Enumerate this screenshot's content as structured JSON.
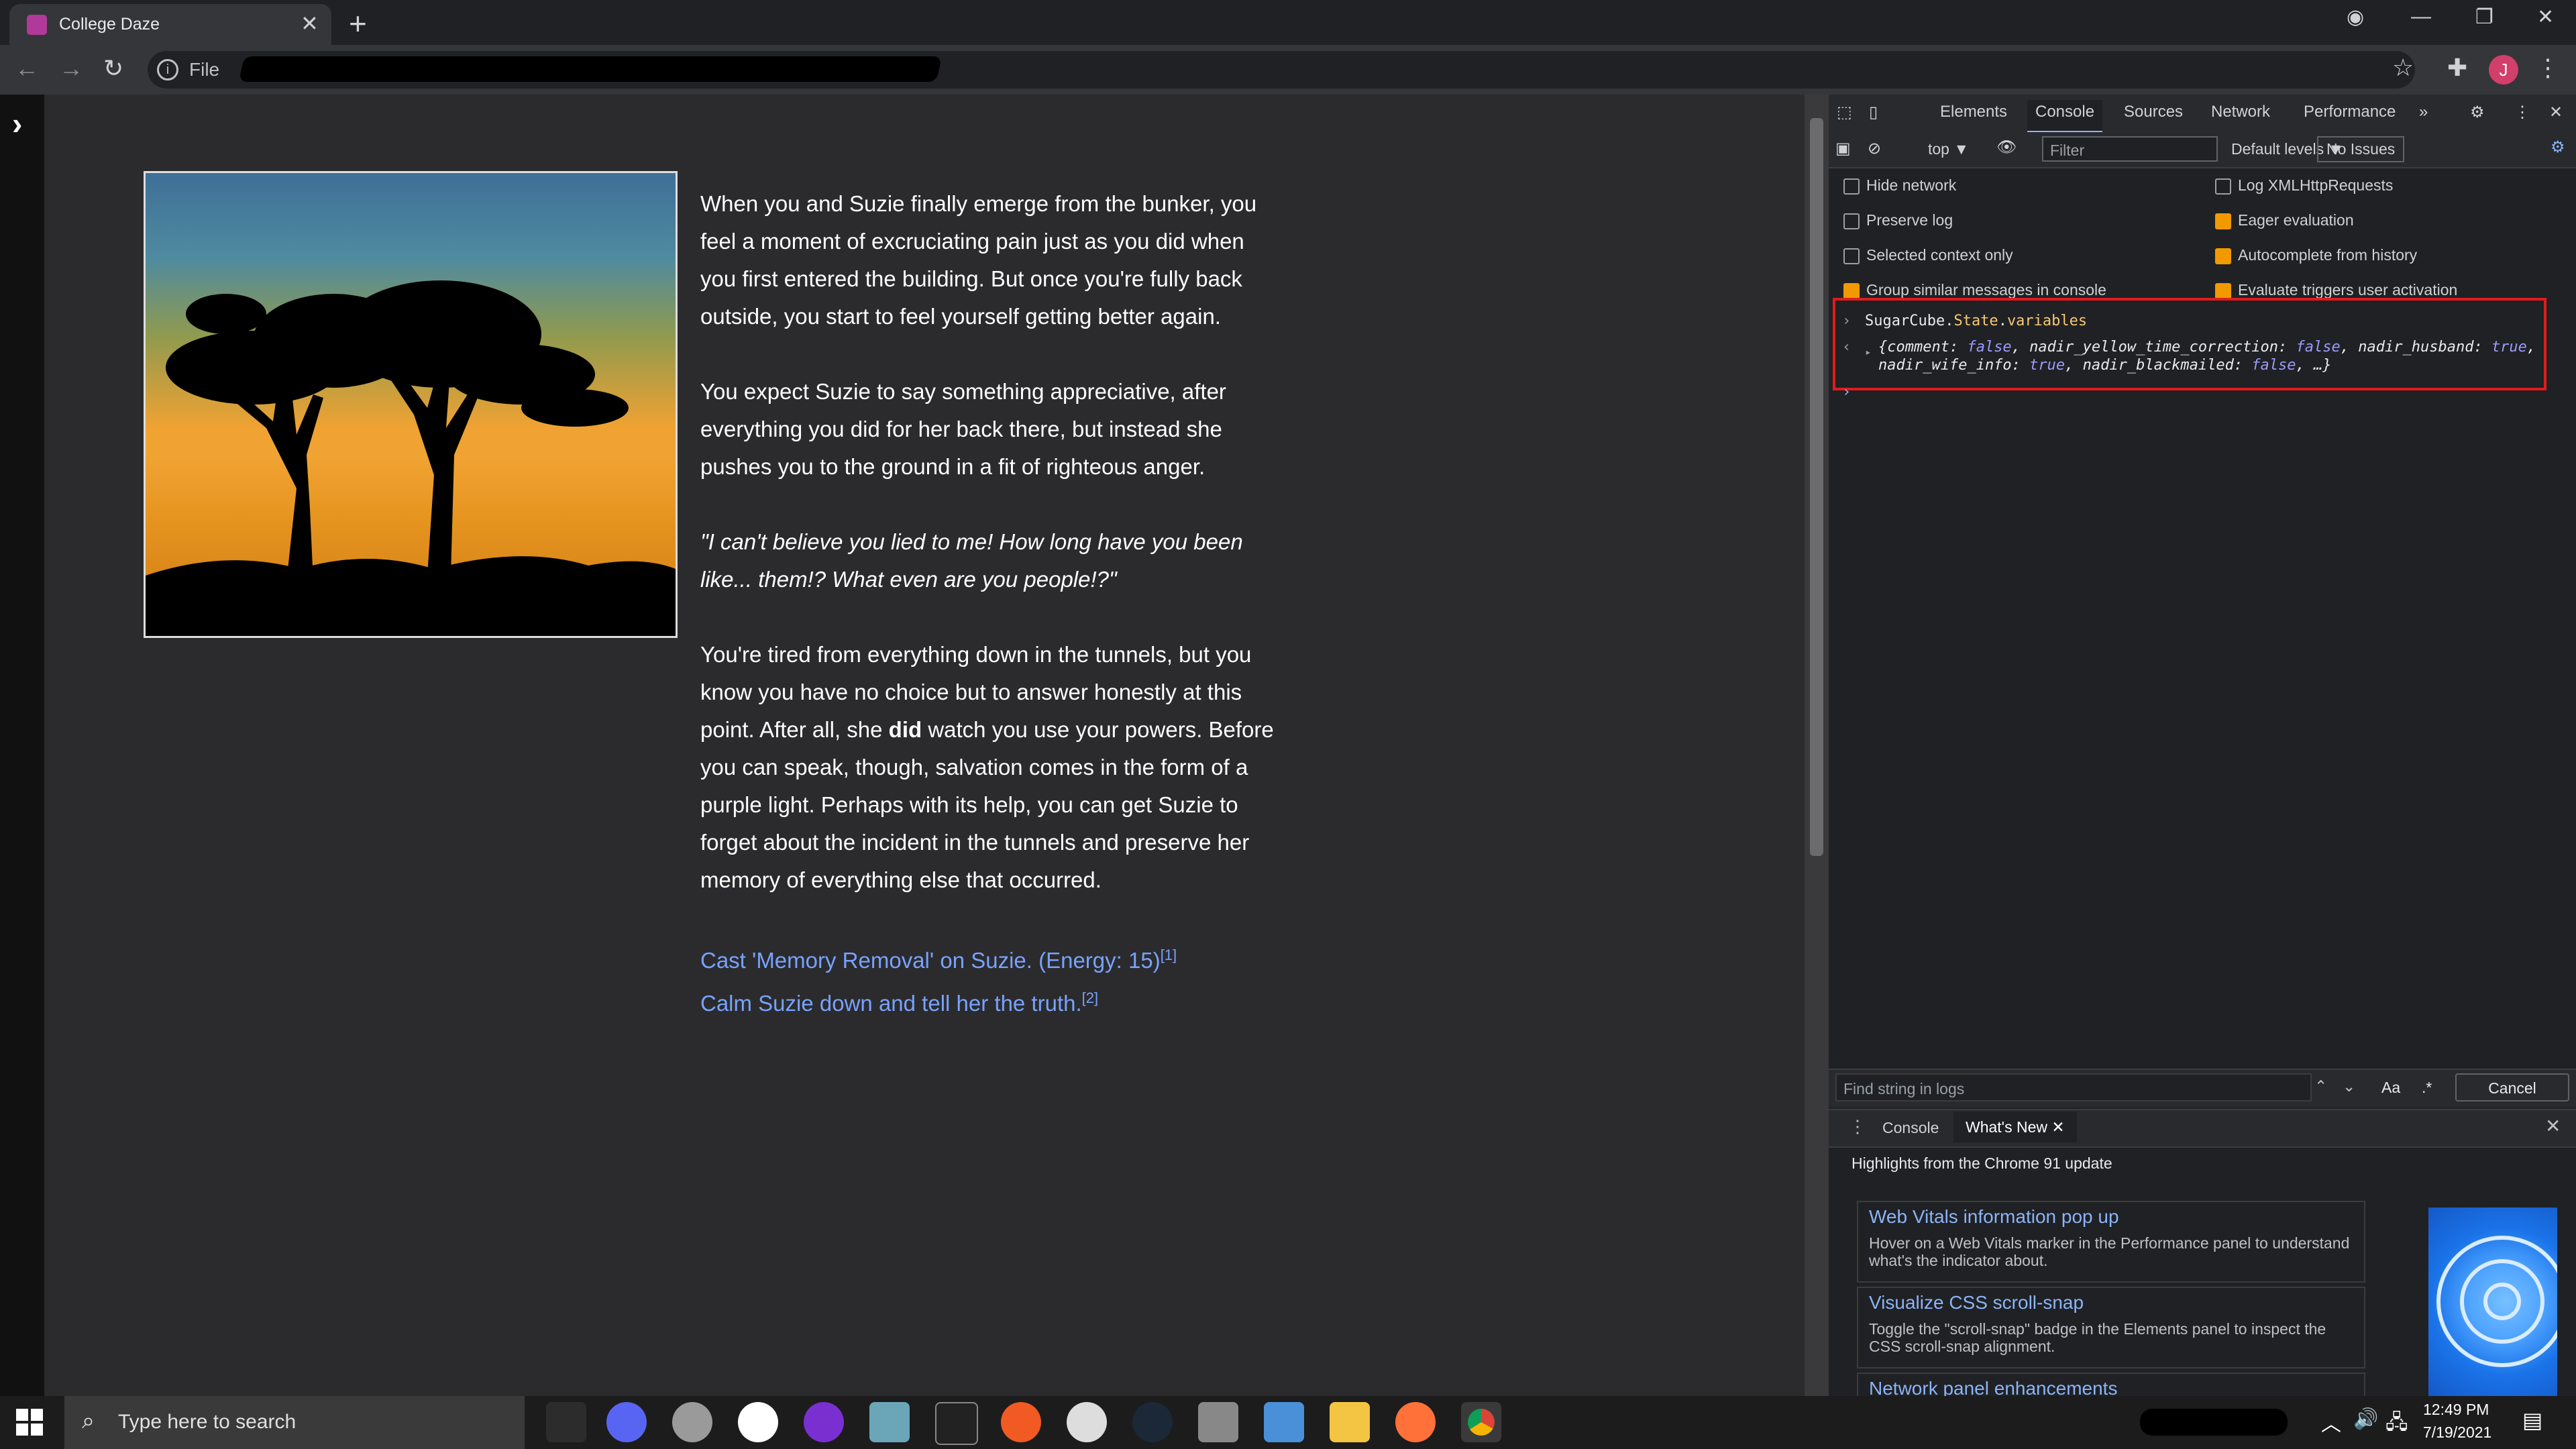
{
  "browser": {
    "tab_title": "College Daze",
    "tab_close": "✕",
    "new_tab": "+",
    "url_label": "File"
  },
  "story": {
    "paragraphs": [
      "When you and Suzie finally emerge from the bunker, you feel a moment of excruciating pain just as you did when you first entered the building. But once you're fully back outside, you start to feel yourself getting better again.",
      "You expect Suzie to say something appreciative, after everything you did for her back there, but instead she pushes you to the ground in a fit of righteous anger."
    ],
    "quote": "\"I can't believe you lied to me! How long have you been like... them!? What even are you people!?\"",
    "p4_before": "You're tired from everything down in the tunnels, but you know you have no choice but to answer honestly at this point. After all, she ",
    "p4_bold": "did",
    "p4_after": " watch you use your powers. Before you can speak, though, salvation comes in the form of a purple light. Perhaps with its help, you can get Suzie to forget about the incident in the tunnels and preserve her memory of everything else that occurred.",
    "choices": [
      {
        "label": "Cast 'Memory Removal' on Suzie. (Energy: 15)",
        "sup": "[1]"
      },
      {
        "label": "Calm Suzie down and tell her the truth.",
        "sup": "[2]"
      }
    ]
  },
  "devtools": {
    "tabs": [
      "Elements",
      "Console",
      "Sources",
      "Network",
      "Performance"
    ],
    "more": "»",
    "context": "top ▼",
    "filter_placeholder": "Filter",
    "levels": "Default levels ▼",
    "issues": "No Issues",
    "settings_left": [
      {
        "label": "Hide network",
        "checked": false
      },
      {
        "label": "Preserve log",
        "checked": false
      },
      {
        "label": "Selected context only",
        "checked": false
      },
      {
        "label": "Group similar messages in console",
        "checked": true
      }
    ],
    "settings_right": [
      {
        "label": "Log XMLHttpRequests",
        "checked": false
      },
      {
        "label": "Eager evaluation",
        "checked": true
      },
      {
        "label": "Autocomplete from history",
        "checked": true
      },
      {
        "label": "Evaluate triggers user activation",
        "checked": true
      }
    ],
    "command": {
      "a": "SugarCube.",
      "b": "State",
      "c": ".",
      "d": "variables"
    },
    "result_line1": "{comment: false, nadir_yellow_time_correction: false, nadir_husband: true,",
    "result_line2": "nadir_wife_info: true, nadir_blackmailed: false, …}",
    "find_placeholder": "Find string in logs",
    "find_case": "Aa",
    "find_regex": ".*",
    "cancel": "Cancel",
    "drawer_console": "Console",
    "drawer_whatsnew": "What's New",
    "highlights": "Highlights from the Chrome 91 update",
    "cards": [
      {
        "title": "Web Vitals information pop up",
        "desc": "Hover on a Web Vitals marker in the Performance panel to understand what's the indicator about."
      },
      {
        "title": "Visualize CSS scroll-snap",
        "desc": "Toggle the \"scroll-snap\" badge in the Elements panel to inspect the CSS scroll-snap alignment."
      },
      {
        "title": "Network panel enhancements",
        "desc": ""
      }
    ]
  },
  "taskbar": {
    "search_placeholder": "Type here to search",
    "time": "12:49 PM",
    "date": "7/19/2021"
  },
  "colors": {
    "link": "#78a2ff",
    "accent": "#8ab4f8",
    "highlight_box": "#e11b1b"
  }
}
